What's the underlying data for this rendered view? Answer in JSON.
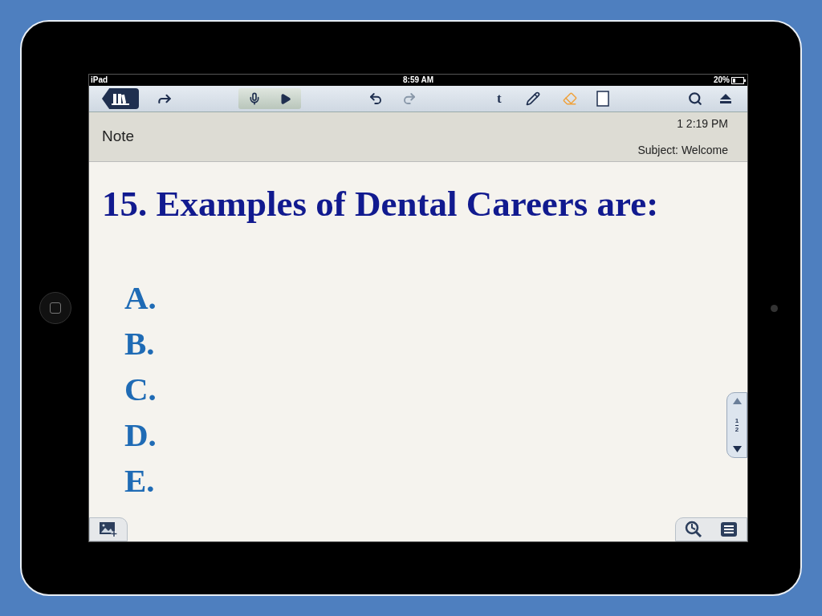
{
  "status_bar": {
    "device": "iPad",
    "time": "8:59 AM",
    "battery": "20%"
  },
  "toolbar": {
    "text_tool": "t"
  },
  "note": {
    "title": "Note",
    "time": "1 2:19 PM",
    "subject": "Subject: Welcome"
  },
  "content": {
    "heading": "15. Examples of Dental Careers are:",
    "items": [
      "A.",
      "B.",
      "C.",
      "D.",
      "E."
    ]
  },
  "pager": {
    "current": "1",
    "total": "2"
  }
}
